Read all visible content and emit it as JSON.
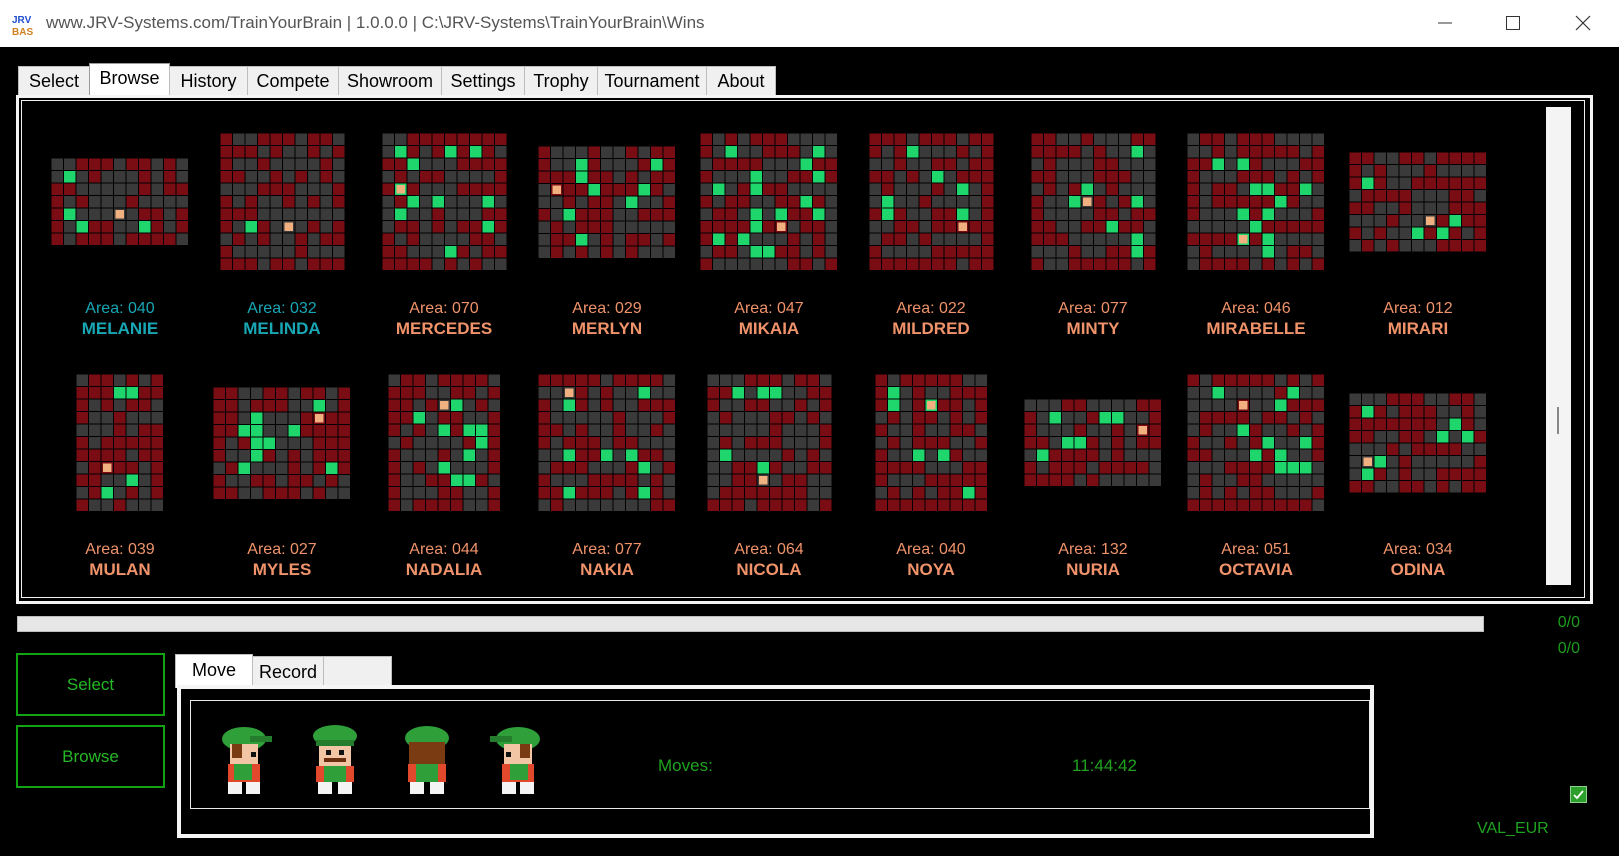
{
  "window": {
    "title": "www.JRV-Systems.com/TrainYourBrain | 1.0.0.0 | C:\\JRV-Systems\\TrainYourBrain\\Wins",
    "icon_text": "JRV"
  },
  "tabs": [
    {
      "label": "Select"
    },
    {
      "label": "Browse",
      "active": true
    },
    {
      "label": "History"
    },
    {
      "label": "Compete"
    },
    {
      "label": "Showroom"
    },
    {
      "label": "Settings"
    },
    {
      "label": "Trophy"
    },
    {
      "label": "Tournament"
    },
    {
      "label": "About"
    }
  ],
  "colors": {
    "solved": "#18a7b5",
    "unsolved": "#f0936a",
    "wall": "#7a0c14",
    "floor": "#3a3a3a",
    "goal": "#1fd66d",
    "accent_green": "#1fa31f"
  },
  "puzzles": [
    {
      "area": "Area: 040",
      "name": "MELANIE",
      "solved": true
    },
    {
      "area": "Area: 032",
      "name": "MELINDA",
      "solved": true
    },
    {
      "area": "Area: 070",
      "name": "MERCEDES",
      "solved": false
    },
    {
      "area": "Area: 029",
      "name": "MERLYN",
      "solved": false
    },
    {
      "area": "Area: 047",
      "name": "MIKAIA",
      "solved": false
    },
    {
      "area": "Area: 022",
      "name": "MILDRED",
      "solved": false
    },
    {
      "area": "Area: 077",
      "name": "MINTY",
      "solved": false
    },
    {
      "area": "Area: 046",
      "name": "MIRABELLE",
      "solved": false
    },
    {
      "area": "Area: 012",
      "name": "MIRARI",
      "solved": false
    },
    {
      "area": "Area: 039",
      "name": "MULAN",
      "solved": false
    },
    {
      "area": "Area: 027",
      "name": "MYLES",
      "solved": false
    },
    {
      "area": "Area: 044",
      "name": "NADALIA",
      "solved": false
    },
    {
      "area": "Area: 077",
      "name": "NAKIA",
      "solved": false
    },
    {
      "area": "Area: 064",
      "name": "NICOLA",
      "solved": false
    },
    {
      "area": "Area: 040",
      "name": "NOYA",
      "solved": false
    },
    {
      "area": "Area: 132",
      "name": "NURIA",
      "solved": false
    },
    {
      "area": "Area: 051",
      "name": "OCTAVIA",
      "solved": false
    },
    {
      "area": "Area: 034",
      "name": "ODINA",
      "solved": false
    }
  ],
  "progress": {
    "value": 0,
    "counter_top": "0/0",
    "counter_bottom": "0/0"
  },
  "actions": {
    "select_label": "Select",
    "browse_label": "Browse"
  },
  "lower_tabs": [
    {
      "label": "Move",
      "active": true
    },
    {
      "label": "Record"
    },
    {
      "label": ""
    }
  ],
  "move_panel": {
    "moves_label": "Moves:",
    "time": "11:44:42"
  },
  "footer": {
    "locale": "VAL_EUR",
    "checkbox_checked": true
  }
}
